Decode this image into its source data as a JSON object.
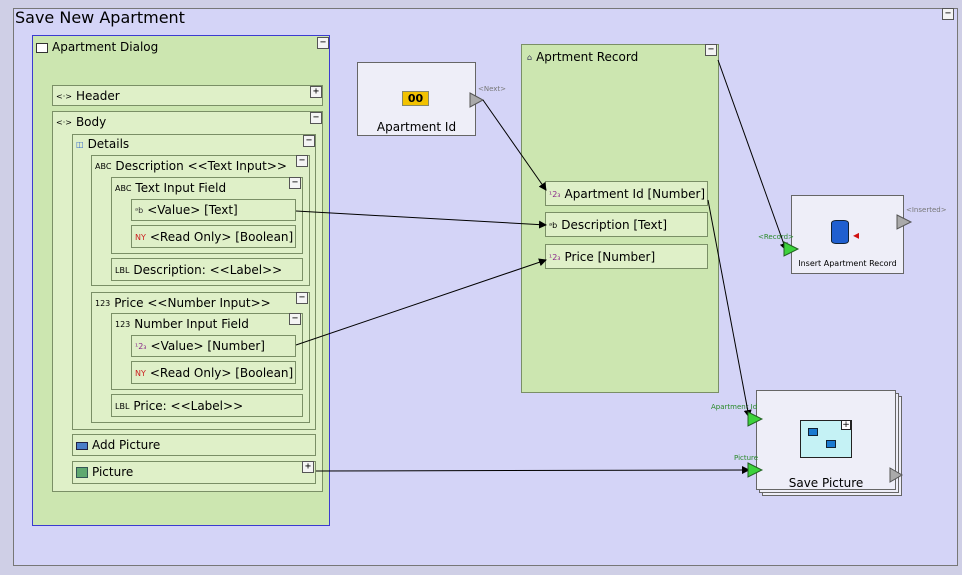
{
  "window": {
    "title": "Save New Apartment",
    "collapse_symbol": "−"
  },
  "dialog": {
    "title": "Apartment Dialog",
    "header": {
      "label": "Header",
      "toggle": "+"
    },
    "body": {
      "label": "Body",
      "toggle": "−"
    },
    "details": {
      "label": "Details",
      "toggle": "−"
    },
    "description": {
      "label": "Description <<Text Input>>",
      "field_label": "Text Input Field",
      "value": "<Value> [Text]",
      "read_only": "<Read Only> [Boolean]",
      "caption": "Description: <<Label>>"
    },
    "price": {
      "label": "Price <<Number Input>>",
      "field_label": "Number Input Field",
      "value": "<Value> [Number]",
      "read_only": "<Read Only> [Boolean]",
      "caption": "Price: <<Label>>"
    },
    "add_picture": "Add Picture",
    "picture": "Picture",
    "picture_toggle": "+"
  },
  "apartment_id_node": {
    "label": "Apartment Id",
    "icon_text": "00",
    "port": "<Next>"
  },
  "record": {
    "title": "Aprtment Record",
    "fields": [
      "Apartment Id [Number]",
      "Description [Text]",
      "Price [Number]"
    ]
  },
  "insert_node": {
    "label": "Insert Apartment Record",
    "in_port": "<Record>",
    "out_port": "<Inserted>"
  },
  "save_picture": {
    "label": "Save Picture",
    "port_id": "Apartment Id",
    "port_picture": "Picture"
  },
  "icons": {
    "text": "ᵃb",
    "boolean": "NY",
    "number": "¹2₃",
    "label": "LBL",
    "abc": "ABC",
    "num123": "123"
  }
}
